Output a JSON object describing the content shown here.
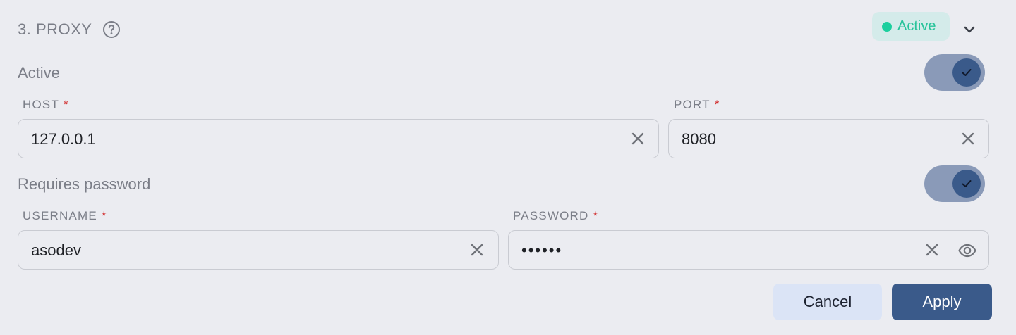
{
  "section": {
    "title": "3. PROXY",
    "status_label": "Active",
    "status_color": "#1ccf9e"
  },
  "active_toggle": {
    "label": "Active",
    "checked": true
  },
  "host": {
    "label": "HOST",
    "required_mark": "*",
    "value": "127.0.0.1"
  },
  "port": {
    "label": "PORT",
    "required_mark": "*",
    "value": "8080"
  },
  "password_toggle": {
    "label": "Requires password",
    "checked": true
  },
  "username": {
    "label": "USERNAME",
    "required_mark": "*",
    "value": "asodev"
  },
  "password": {
    "label": "PASSWORD",
    "required_mark": "*",
    "value": "••••••"
  },
  "buttons": {
    "cancel": "Cancel",
    "apply": "Apply"
  },
  "icons": {
    "help": "help-circle-icon",
    "chevron": "chevron-down-icon",
    "clear": "close-icon",
    "reveal": "eye-icon",
    "check": "check-icon"
  },
  "colors": {
    "accent": "#3a5a8a",
    "required": "#d12a2a",
    "background": "#ebecf1"
  }
}
